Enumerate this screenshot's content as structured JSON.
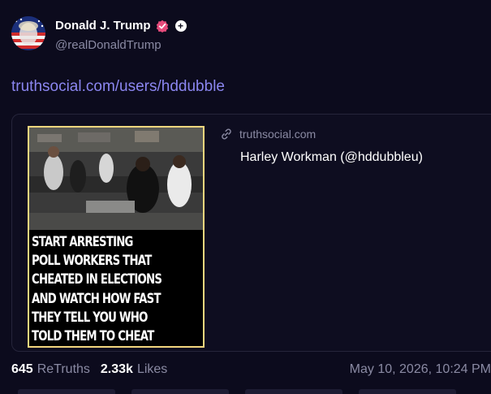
{
  "post": {
    "author_name": "Donald J. Trump",
    "author_handle": "@realDonaldTrump",
    "link_text": "truthsocial.com/users/hddubble",
    "icons": {
      "verified": "verified-check-icon",
      "plus": "plus-badge-icon",
      "link": "link-chain-icon"
    },
    "colors": {
      "background": "#0c0b1d",
      "link": "#8b86f0",
      "muted": "#8a8aa3",
      "verified": "#e64b7b",
      "image_border": "#f2d67e"
    }
  },
  "card": {
    "domain": "truthsocial.com",
    "title": "Harley Workman (@hddubbleu)",
    "image_caption": [
      "START ARRESTING",
      "POLL WORKERS THAT",
      "CHEATED IN ELECTIONS",
      "AND WATCH HOW FAST",
      "THEY TELL YOU WHO",
      "TOLD THEM TO CHEAT"
    ]
  },
  "stats": {
    "retruths_count": "645",
    "retruths_label": "ReTruths",
    "likes_count": "2.33k",
    "likes_label": "Likes",
    "timestamp": "May 10, 2026, 10:24 PM"
  }
}
